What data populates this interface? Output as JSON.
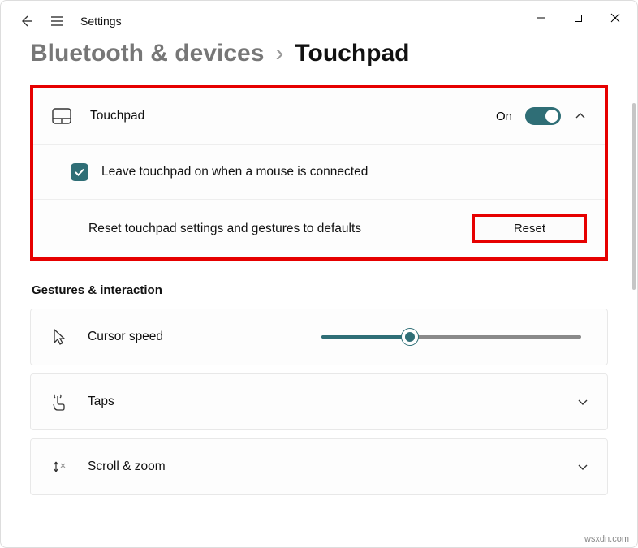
{
  "window": {
    "title": "Settings"
  },
  "breadcrumb": {
    "parent": "Bluetooth & devices",
    "sep": "›",
    "current": "Touchpad"
  },
  "touchpad_panel": {
    "label": "Touchpad",
    "state_text": "On",
    "leave_on_label": "Leave touchpad on when a mouse is connected",
    "reset_label": "Reset touchpad settings and gestures to defaults",
    "reset_button": "Reset"
  },
  "section": {
    "title": "Gestures & interaction"
  },
  "cursor_speed": {
    "label": "Cursor speed"
  },
  "taps": {
    "label": "Taps"
  },
  "scroll_zoom": {
    "label": "Scroll & zoom"
  },
  "watermark": "wsxdn.com"
}
